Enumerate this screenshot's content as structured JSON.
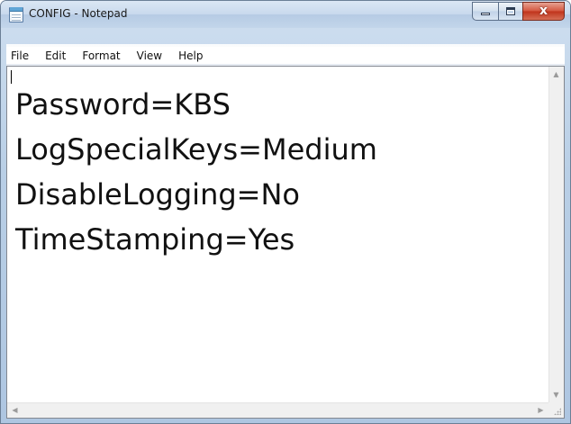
{
  "window": {
    "title": "CONFIG - Notepad",
    "close_glyph": "x"
  },
  "menu": {
    "items": [
      "File",
      "Edit",
      "Format",
      "View",
      "Help"
    ]
  },
  "document": {
    "lines": [
      "Password=KBS",
      "LogSpecialKeys=Medium",
      "DisableLogging=No",
      "TimeStamping=Yes"
    ]
  },
  "icons": {
    "app": "notepad-icon",
    "minimize": "minimize-icon",
    "maximize": "maximize-icon",
    "close": "close-icon",
    "scroll_up": "arrow-up-icon",
    "scroll_down": "arrow-down-icon",
    "scroll_left": "arrow-left-icon",
    "scroll_right": "arrow-right-icon",
    "size_grip": "size-grip-icon"
  },
  "colors": {
    "close_button": "#c7432b",
    "frame": "#b9cfe6"
  }
}
